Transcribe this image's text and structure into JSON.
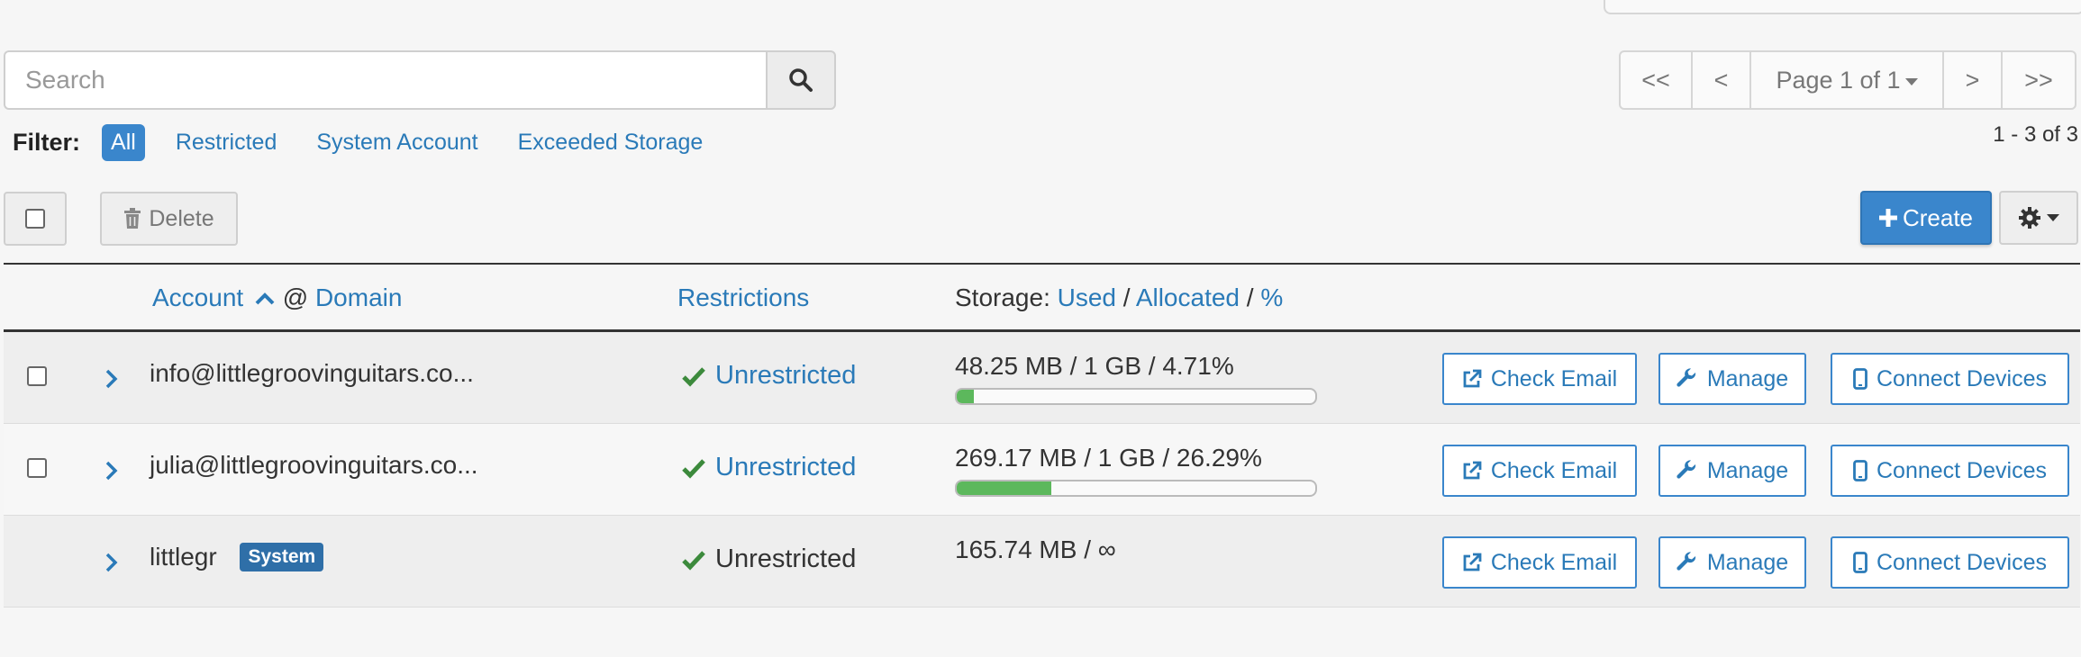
{
  "search": {
    "placeholder": "Search",
    "value": ""
  },
  "pagination": {
    "first": "<<",
    "prev": "<",
    "page": "Page 1 of 1",
    "next": ">",
    "last": ">>",
    "range": "1 - 3 of 3"
  },
  "filter": {
    "label": "Filter:",
    "options": [
      "All",
      "Restricted",
      "System Account",
      "Exceeded Storage"
    ],
    "active": "All"
  },
  "toolbar": {
    "delete": "Delete",
    "create": "Create"
  },
  "columns": {
    "account": "Account",
    "at": "@",
    "domain": "Domain",
    "restrictions": "Restrictions",
    "storage_prefix": "Storage:",
    "used": "Used",
    "slash1": "/",
    "allocated": "Allocated",
    "slash2": "/",
    "percent": "%"
  },
  "rows": [
    {
      "account": "info@littlegroovinguitars.co...",
      "restriction": "Unrestricted",
      "restriction_link": true,
      "storage": "48.25 MB / 1 GB / 4.71%",
      "usage_fraction": 0.0471,
      "has_checkbox": true,
      "badge": ""
    },
    {
      "account": "julia@littlegroovinguitars.co...",
      "restriction": "Unrestricted",
      "restriction_link": true,
      "storage": "269.17 MB / 1 GB / 26.29%",
      "usage_fraction": 0.2629,
      "has_checkbox": true,
      "badge": ""
    },
    {
      "account": "littlegr",
      "restriction": "Unrestricted",
      "restriction_link": false,
      "storage": "165.74 MB / ∞",
      "usage_fraction": null,
      "has_checkbox": false,
      "badge": "System"
    }
  ],
  "actions": {
    "check_email": "Check Email",
    "manage": "Manage",
    "connect_devices": "Connect Devices"
  },
  "colors": {
    "accent": "#3a86cc",
    "link": "#2a7ab8",
    "success": "#3c8a3c",
    "progress": "#5cb85c"
  }
}
